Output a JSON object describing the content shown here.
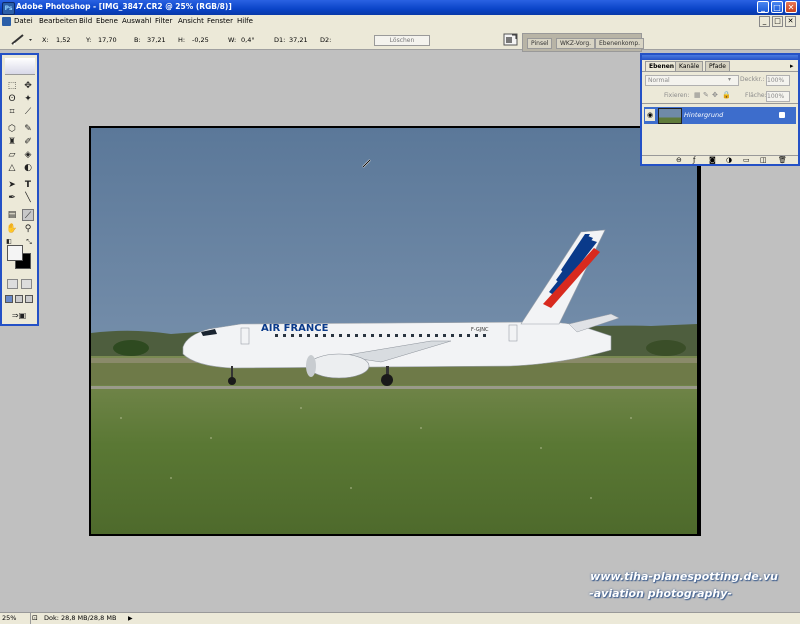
{
  "window": {
    "title": "Adobe Photoshop - [IMG_3847.CR2 @ 25% (RGB/8)]",
    "app_icon": "Ps",
    "min_glyph": "_",
    "max_glyph": "□",
    "close_glyph": "✕"
  },
  "menubar": {
    "items": [
      "Datei",
      "Bearbeiten",
      "Bild",
      "Ebene",
      "Auswahl",
      "Filter",
      "Ansicht",
      "Fenster",
      "Hilfe"
    ],
    "doc_min_glyph": "_",
    "doc_max_glyph": "□",
    "doc_close_glyph": "✕"
  },
  "options_bar": {
    "x_label": "X:",
    "x_value": "1,52",
    "y_label": "Y:",
    "y_value": "17,70",
    "b_label": "B:",
    "b_value": "37,21",
    "h_label": "H:",
    "h_value": "-0,25",
    "w_label": "W:",
    "w_value": "0,4°",
    "d1_label": "D1:",
    "d1_value": "37,21",
    "d2_label": "D2:",
    "clear_button": "Löschen",
    "well_tabs": [
      "Pinsel",
      "WKZ-Vorg.",
      "Ebenenkomp."
    ]
  },
  "layers_panel": {
    "tabs": [
      "Ebenen",
      "Kanäle",
      "Pfade"
    ],
    "blend_mode": "Normal",
    "opacity_label": "Deckkr.:",
    "opacity_value": "100%",
    "lock_label": "Fixieren:",
    "fill_label": "Fläche:",
    "fill_value": "100%",
    "layer_name": "Hintergrund"
  },
  "photo": {
    "airline": "AIR FRANCE",
    "registration": "F-GJNC",
    "colors": {
      "sky": "#6f8aa8",
      "grass": "#5e7a3a",
      "blue": "#0a3a8a",
      "red": "#d82a1e"
    }
  },
  "statusbar": {
    "zoom": "25%",
    "doc_info": "Dok: 28,8 MB/28,8 MB",
    "arrow": "▶"
  },
  "watermark": {
    "line1": "www.tiha-planespotting.de.vu",
    "line2": "-aviation photography-"
  }
}
